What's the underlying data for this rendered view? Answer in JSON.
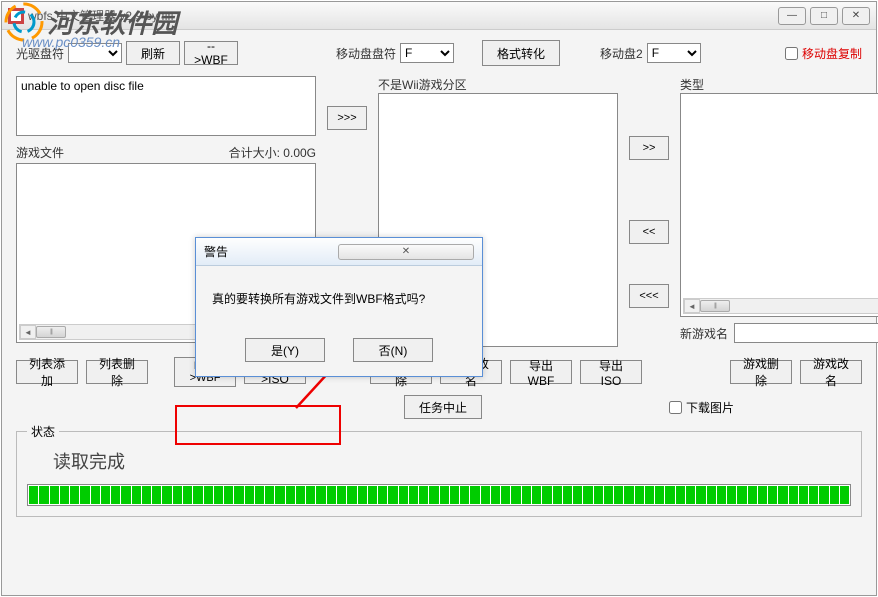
{
  "window": {
    "title": "wbfs 中文管理器 v2.9 by flfl",
    "min_label": "—",
    "max_label": "□",
    "close_label": "✕"
  },
  "watermark": {
    "text": "河东软件园",
    "sub": "www.pc0359.cn"
  },
  "top": {
    "drive_label_1": "光驱盘符",
    "refresh": "刷新",
    "to_wbf": "-->WBF",
    "mobile_drive": "移动盘盘符",
    "mobile_drive_value": "F",
    "format": "格式转化",
    "mobile_disk2": "移动盘2",
    "mobile_disk2_value": "F",
    "mobile_copy": "移动盘复制"
  },
  "labels": {
    "game_file": "游戏文件",
    "total_size": "合计大小: 0.00G",
    "not_wii": "不是Wii游戏分区",
    "type": "类型",
    "new_game": "新游戏名",
    "status": "状态",
    "download_image": "下载图片"
  },
  "disc_info_text": "unable to open disc file",
  "arrows": {
    "r1": ">>>",
    "r2": ">>",
    "r3": "<<",
    "r4": "<<<"
  },
  "buttons": {
    "list_add": "列表添加",
    "list_delete": "列表删除",
    "iso_to_wbf": "ISO->WBF",
    "wbf_to_iso": "WBF->ISO",
    "game_delete": "游戏删除",
    "game_rename": "游戏改名",
    "export_wbf": "导出WBF",
    "export_iso": "导出ISO",
    "task_abort": "任务中止"
  },
  "status_text": "读取完成",
  "dialog": {
    "title": "警告",
    "message": "真的要转换所有游戏文件到WBF格式吗?",
    "yes": "是(Y)",
    "no": "否(N)"
  }
}
